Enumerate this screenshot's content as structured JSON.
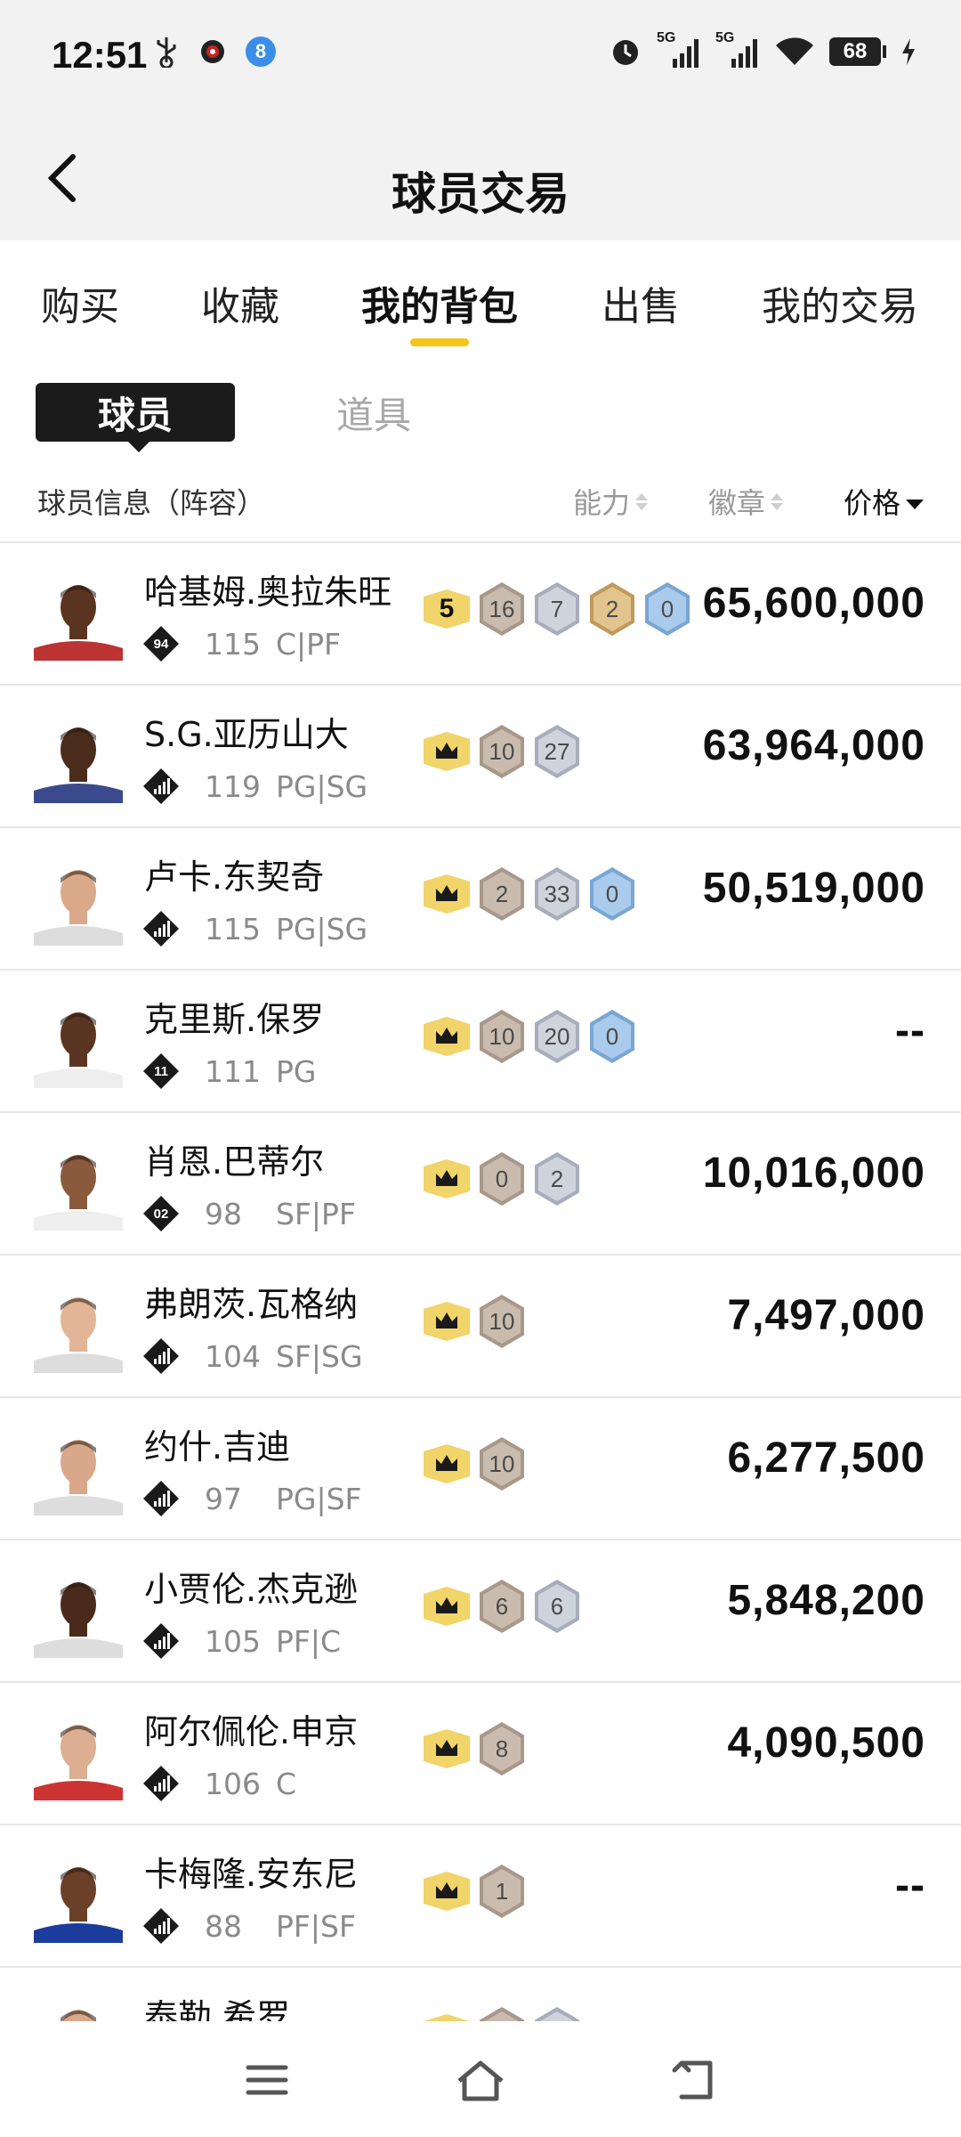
{
  "status_bar": {
    "time": "12:51",
    "battery": "68",
    "network_1": "5G",
    "network_2": "5G",
    "icons_left": [
      "usb-icon",
      "app-notification-icon",
      "app-badge-8-icon"
    ],
    "badge_number": "8"
  },
  "app_bar": {
    "title": "球员交易"
  },
  "tabs": [
    {
      "label": "购买"
    },
    {
      "label": "收藏"
    },
    {
      "label": "我的背包",
      "active": true
    },
    {
      "label": "出售"
    },
    {
      "label": "我的交易"
    }
  ],
  "segment": {
    "active": "球员",
    "inactive": "道具"
  },
  "columns": {
    "info": "球员信息（阵容）",
    "ability": "能力",
    "badges": "徽章",
    "price": "价格"
  },
  "colors": {
    "accent": "#f5c518",
    "gold_badge": "#f1d46a",
    "bronze_badge": "#b0a295",
    "silver_badge": "#b7bcc8",
    "goldtier_badge": "#d2b074",
    "blue_badge": "#8db3da"
  },
  "players": [
    {
      "name": "哈基姆.奥拉朱旺",
      "emblem": "94",
      "ovr": "115",
      "pos": "C|PF",
      "tier": "5",
      "badges": [
        {
          "type": "bronze",
          "value": "16"
        },
        {
          "type": "silver",
          "value": "7"
        },
        {
          "type": "gold",
          "value": "2"
        },
        {
          "type": "blue",
          "value": "0"
        }
      ],
      "price": "65,600,000",
      "skin": "#5a3420",
      "jersey": "#b33"
    },
    {
      "name": "S.G.亚历山大",
      "emblem": "",
      "ovr": "119",
      "pos": "PG|SG",
      "tier": "crown",
      "badges": [
        {
          "type": "bronze",
          "value": "10"
        },
        {
          "type": "silver",
          "value": "27"
        }
      ],
      "price": "63,964,000",
      "skin": "#4a2c1c",
      "jersey": "#3a4a8c"
    },
    {
      "name": "卢卡.东契奇",
      "emblem": "",
      "ovr": "115",
      "pos": "PG|SG",
      "tier": "crown",
      "badges": [
        {
          "type": "bronze",
          "value": "2"
        },
        {
          "type": "silver",
          "value": "33"
        },
        {
          "type": "blue",
          "value": "0"
        }
      ],
      "price": "50,519,000",
      "skin": "#d9a98a",
      "jersey": "#ddd"
    },
    {
      "name": "克里斯.保罗",
      "emblem": "11",
      "ovr": "111",
      "pos": "PG",
      "tier": "crown",
      "badges": [
        {
          "type": "bronze",
          "value": "10"
        },
        {
          "type": "silver",
          "value": "20"
        },
        {
          "type": "blue",
          "value": "0"
        }
      ],
      "price": "--",
      "skin": "#5a3522",
      "jersey": "#eee"
    },
    {
      "name": "肖恩.巴蒂尔",
      "emblem": "02",
      "ovr": "98",
      "pos": "SF|PF",
      "tier": "crown",
      "badges": [
        {
          "type": "bronze",
          "value": "0"
        },
        {
          "type": "silver",
          "value": "2"
        }
      ],
      "price": "10,016,000",
      "skin": "#8a5a3c",
      "jersey": "#eee"
    },
    {
      "name": "弗朗茨.瓦格纳",
      "emblem": "",
      "ovr": "104",
      "pos": "SF|SG",
      "tier": "crown",
      "badges": [
        {
          "type": "bronze",
          "value": "10"
        }
      ],
      "price": "7,497,000",
      "skin": "#e2b596",
      "jersey": "#ddd"
    },
    {
      "name": "约什.吉迪",
      "emblem": "",
      "ovr": "97",
      "pos": "PG|SF",
      "tier": "crown",
      "badges": [
        {
          "type": "bronze",
          "value": "10"
        }
      ],
      "price": "6,277,500",
      "skin": "#d9a78a",
      "jersey": "#ddd"
    },
    {
      "name": "小贾伦.杰克逊",
      "emblem": "",
      "ovr": "105",
      "pos": "PF|C",
      "tier": "crown",
      "badges": [
        {
          "type": "bronze",
          "value": "6"
        },
        {
          "type": "silver",
          "value": "6"
        }
      ],
      "price": "5,848,200",
      "skin": "#4a2a1a",
      "jersey": "#ddd"
    },
    {
      "name": "阿尔佩伦.申京",
      "emblem": "",
      "ovr": "106",
      "pos": "C",
      "tier": "crown",
      "badges": [
        {
          "type": "bronze",
          "value": "8"
        }
      ],
      "price": "4,090,500",
      "skin": "#dcae92",
      "jersey": "#c33"
    },
    {
      "name": "卡梅隆.安东尼",
      "emblem": "",
      "ovr": "88",
      "pos": "PF|SF",
      "tier": "crown",
      "badges": [
        {
          "type": "bronze",
          "value": "1"
        }
      ],
      "price": "--",
      "skin": "#6a4028",
      "jersey": "#1c3c9c"
    },
    {
      "name": "泰勒.希罗",
      "emblem": "",
      "ovr": "",
      "pos": "",
      "tier": "crown",
      "badges": [
        {
          "type": "bronze",
          "value": ""
        },
        {
          "type": "silver",
          "value": ""
        }
      ],
      "price": "",
      "skin": "#d9a98a",
      "jersey": "#ddd"
    }
  ]
}
